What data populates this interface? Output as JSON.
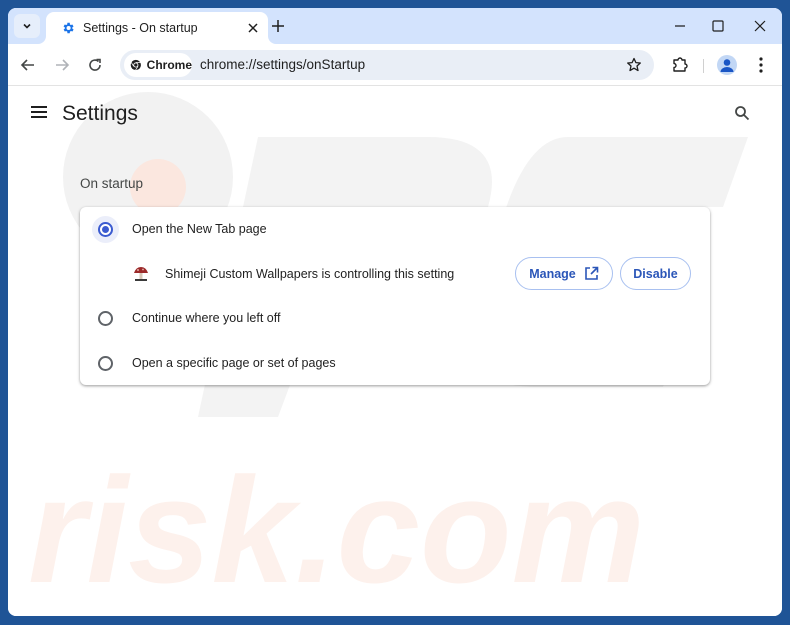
{
  "browser": {
    "tab": {
      "title": "Settings - On startup",
      "favicon": "settings-gear-icon"
    },
    "omnibox": {
      "chip_label": "Chrome",
      "url": "chrome://settings/onStartup"
    },
    "accent": "#1a73e8"
  },
  "settings": {
    "title": "Settings",
    "section_title": "On startup",
    "options": [
      {
        "label": "Open the New Tab page",
        "checked": true
      },
      {
        "label": "Continue where you left off",
        "checked": false
      },
      {
        "label": "Open a specific page or set of pages",
        "checked": false
      }
    ],
    "extension_notice": {
      "text": "Shimeji Custom Wallpapers is controlling this setting",
      "manage_label": "Manage",
      "disable_label": "Disable"
    }
  },
  "watermark": {
    "text": "PC risk.com"
  }
}
